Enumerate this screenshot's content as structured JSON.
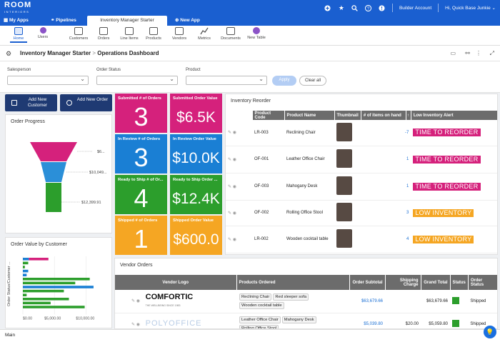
{
  "topbar": {
    "brand_main": "ROOM",
    "brand_sub": "INTERIORS",
    "builder_account": "Builder Account",
    "greeting": "Hi, Quick Base Junkie",
    "icons": [
      "plus-icon",
      "star-icon",
      "search-icon",
      "help-icon",
      "alert-icon"
    ]
  },
  "tabs": [
    {
      "label": "My Apps",
      "icon": "grid-icon"
    },
    {
      "label": "Pipelines",
      "icon": "pipelines-icon"
    },
    {
      "label": "Inventory Manager Starter",
      "icon": ""
    },
    {
      "label": "New App",
      "icon": "plus-circle-icon"
    }
  ],
  "nav": [
    {
      "label": "Home",
      "icon": "home-icon"
    },
    {
      "label": "Users",
      "icon": "users-icon"
    },
    {
      "label": "Customers",
      "icon": "customers-icon"
    },
    {
      "label": "Orders",
      "icon": "orders-icon"
    },
    {
      "label": "Line Items",
      "icon": "line-items-icon"
    },
    {
      "label": "Products",
      "icon": "products-icon"
    },
    {
      "label": "Vendors",
      "icon": "vendors-icon"
    },
    {
      "label": "Metrics",
      "icon": "metrics-icon"
    },
    {
      "label": "Documents",
      "icon": "documents-icon"
    },
    {
      "label": "New Table",
      "icon": "new-table-icon"
    }
  ],
  "breadcrumb": {
    "app": "Inventory Manager Starter",
    "separator": ">",
    "page": "Operations Dashboard"
  },
  "filters": {
    "salesperson_label": "Salesperson",
    "order_status_label": "Order Status",
    "product_label": "Product",
    "apply": "Apply",
    "clear": "Clear all"
  },
  "actions": {
    "add_customer": "Add New Customer",
    "add_order": "Add New Order"
  },
  "order_progress": {
    "title": "Order Progress",
    "funnel_labels": [
      "$6...",
      "$10,049...",
      "$12,399.91"
    ],
    "colors": [
      "#d5217c",
      "#2b8fd8",
      "#2c9e2c"
    ]
  },
  "tiles": [
    {
      "label": "Submitted # of Orders",
      "value": "3",
      "color": "#d5217c"
    },
    {
      "label": "Submitted Order Value",
      "value": "$6.5K",
      "color": "#d5217c"
    },
    {
      "label": "In Review # of Orders",
      "value": "3",
      "color": "#1a7fd4"
    },
    {
      "label": "In Review Order Value",
      "value": "$10.0K",
      "color": "#1a7fd4"
    },
    {
      "label": "Ready to Ship # of Or...",
      "value": "4",
      "color": "#2c9e2c"
    },
    {
      "label": "Ready to Ship Order ...",
      "value": "$12.4K",
      "color": "#2c9e2c"
    },
    {
      "label": "Shipped # of Orders",
      "value": "1",
      "color": "#f5a623"
    },
    {
      "label": "Shipped Order Value",
      "value": "$600.0",
      "color": "#f5a623"
    }
  ],
  "inventory": {
    "title": "Inventory Reorder",
    "headers": [
      "Product Code",
      "Product Name",
      "Thumbnail",
      "# of items on hand",
      "Low Inventory Alert"
    ],
    "sort_indicator": "↑",
    "rows": [
      {
        "code": "LR-003",
        "name": "Reclining Chair",
        "qty": "-7",
        "alert": "TIME TO REORDER",
        "alert_color": "#d5217c"
      },
      {
        "code": "OF-001",
        "name": "Leather Office Chair",
        "qty": "1",
        "alert": "TIME TO REORDER",
        "alert_color": "#d5217c"
      },
      {
        "code": "OF-003",
        "name": "Mahogany Desk",
        "qty": "1",
        "alert": "TIME TO REORDER",
        "alert_color": "#d5217c"
      },
      {
        "code": "OF-002",
        "name": "Rolling Office Stool",
        "qty": "3",
        "alert": "LOW INVENTORY",
        "alert_color": "#f5a623"
      },
      {
        "code": "LR-002",
        "name": "Wooden cocktail table",
        "qty": "4",
        "alert": "LOW INVENTORY",
        "alert_color": "#f5a623"
      }
    ]
  },
  "order_value": {
    "title": "Order Value by Customer",
    "ylabel": "Order Status/Customer ...",
    "ticks": [
      "$0.00",
      "$5,000.00",
      "$10,000.00"
    ],
    "xlim": [
      0,
      12000
    ],
    "bars": [
      {
        "value": 950,
        "color": "#1a7fd4"
      },
      {
        "value": 3100,
        "color": "#d5217c"
      },
      {
        "value": 850,
        "color": "#2c9e2c"
      },
      {
        "value": 320,
        "color": "#2c9e2c"
      },
      {
        "value": 850,
        "color": "#1a7fd4"
      },
      {
        "value": 600,
        "color": "#1a7fd4"
      },
      {
        "value": 10600,
        "color": "#2c9e2c"
      },
      {
        "value": 8300,
        "color": "#2c9e2c"
      },
      {
        "value": 11200,
        "color": "#1a7fd4"
      },
      {
        "value": 6500,
        "color": "#2c9e2c"
      },
      {
        "value": 600,
        "color": "#2c9e2c"
      },
      {
        "value": 7300,
        "color": "#2c9e2c"
      },
      {
        "value": 4400,
        "color": "#2c9e2c"
      },
      {
        "value": 9800,
        "color": "#2c9e2c"
      }
    ]
  },
  "vendor_orders": {
    "title": "Vendor Orders",
    "headers": [
      "Vendor Logo",
      "Products Ordered",
      "Order Subtotal",
      "Shipping Charge",
      "Grand Total",
      "Status",
      "Order Status"
    ],
    "rows": [
      {
        "logo": "COMFORTIC",
        "logo_sub": "THE WELLBEING SINCE 1983",
        "products": [
          "Reclining Chair",
          "Red sleeper sofa",
          "Wooden cocktail table"
        ],
        "subtotal": "$63,679.66",
        "shipping": "",
        "total": "$63,679.66",
        "status_color": "#2c9e2c",
        "order_status": "Shipped"
      },
      {
        "logo": "POLYOFFICE",
        "logo_sub": "",
        "products": [
          "Leather Office Chair",
          "Mahogany Desk",
          "Rolling Office Stool"
        ],
        "subtotal": "$5,039.80",
        "shipping": "$20.00",
        "total": "$5,059.80",
        "status_color": "#2c9e2c",
        "order_status": "Shipped"
      }
    ]
  },
  "statusbar": {
    "label": "Main"
  }
}
